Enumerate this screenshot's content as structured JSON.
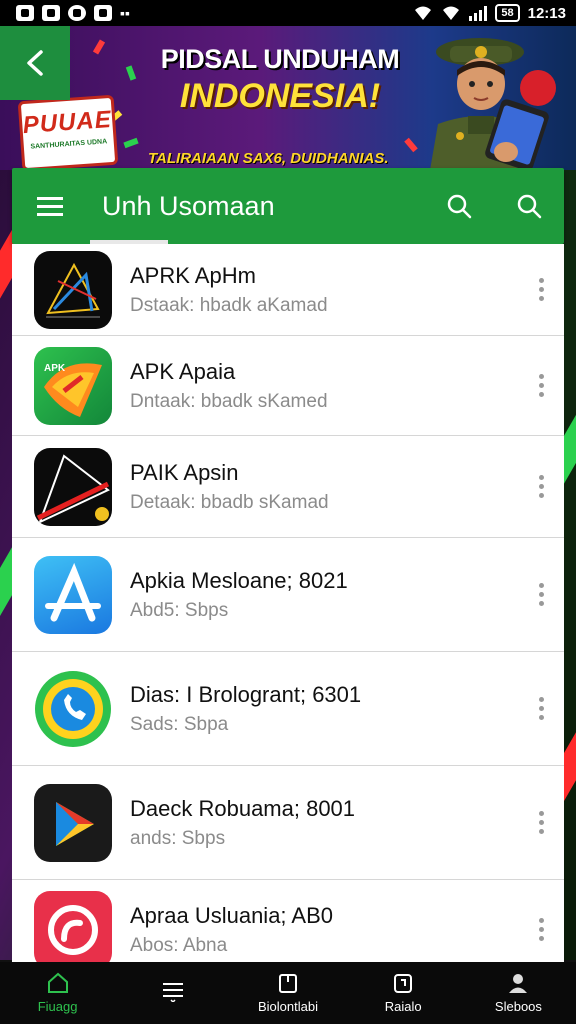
{
  "status_bar": {
    "time": "12:13",
    "battery": "58"
  },
  "banner": {
    "title_line1": "PIDSAL UNDUHAM",
    "title_line2": "INDONESIA!",
    "subtitle": "TALIRAIAAN SAX6, DUIDHANIAS.",
    "logo_text": "PUUAE",
    "logo_subtext": "SANTHURAITAS UDNA",
    "accent": "#ffe23a"
  },
  "header": {
    "title": "Unh Usomaan",
    "color": "#1e9a3c"
  },
  "apps": [
    {
      "name": "APRK ApHm",
      "subtitle": "Dstaak: hbadk  aKamad",
      "icon": "dark-abstract-icon"
    },
    {
      "name": "APK Apaia",
      "subtitle": "Dntaak: bbadk  sKamed",
      "icon": "green-orange-logo-icon"
    },
    {
      "name": "PAIK Apsin",
      "subtitle": "Detaak: bbadb  sKamad",
      "icon": "black-red-triangle-icon"
    },
    {
      "name": "Apkia Mesloane; 8021",
      "subtitle": "Abd5: Sbps",
      "icon": "blue-a-icon"
    },
    {
      "name": "Dias: I Brologrant; 6301",
      "subtitle": "Sads: Sbpa",
      "icon": "phone-circle-icon"
    },
    {
      "name": "Daeck Robuama; 8001",
      "subtitle": "ands: Sbps",
      "icon": "play-triangle-icon"
    },
    {
      "name": "Apraa Usluania; AB0",
      "subtitle": "Abos: Abna",
      "icon": "red-swirl-icon"
    }
  ],
  "bottom_nav": [
    {
      "label": "Fiuagg",
      "icon": "home-icon",
      "active": true
    },
    {
      "label": "",
      "icon": "list-icon",
      "active": false
    },
    {
      "label": "Biolontlabi",
      "icon": "box-icon",
      "active": false
    },
    {
      "label": "Raialo",
      "icon": "bag-icon",
      "active": false
    },
    {
      "label": "Sleboos",
      "icon": "user-icon",
      "active": false
    }
  ]
}
